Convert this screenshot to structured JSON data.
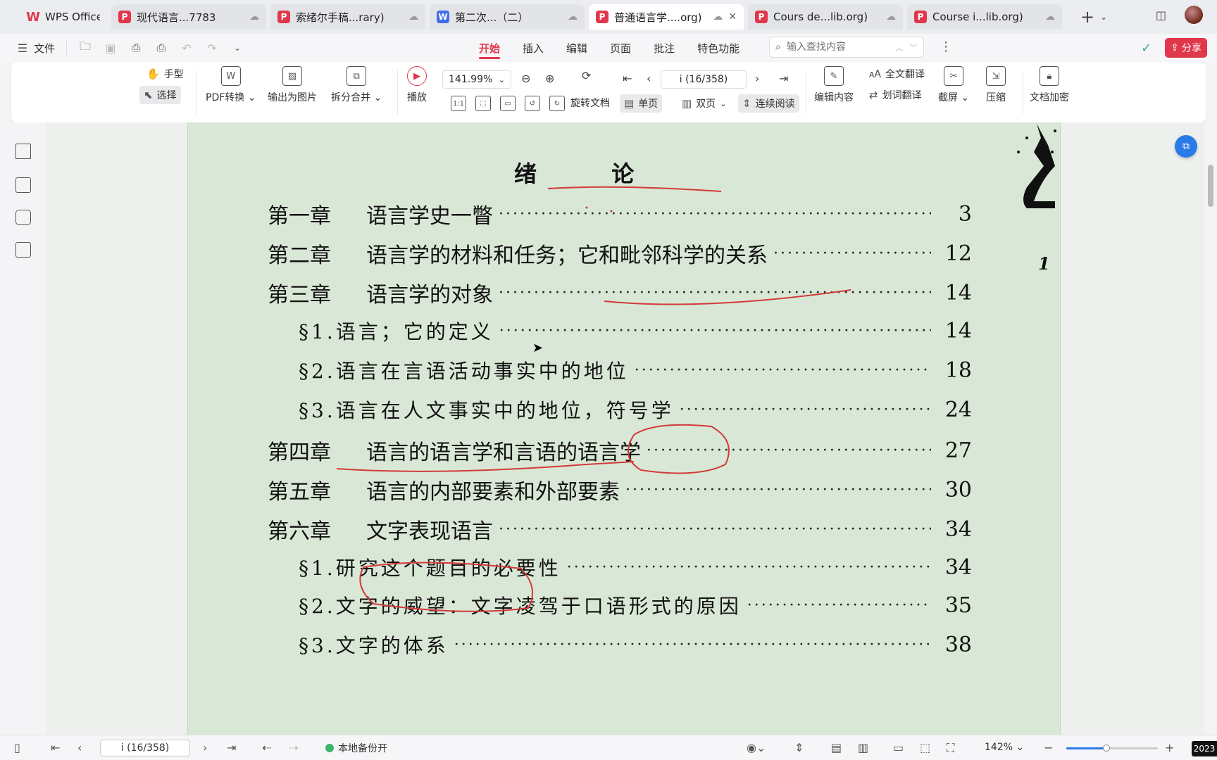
{
  "tabs": [
    {
      "label": "WPS Office",
      "icon": "wps-logo-icon",
      "type": "home"
    },
    {
      "label": "现代语言...7783",
      "icon": "pdf-icon",
      "type": "doc"
    },
    {
      "label": "索绪尔手稿...rary)",
      "icon": "pdf-icon",
      "type": "doc"
    },
    {
      "label": "第二次...（二）",
      "icon": "word-icon",
      "type": "doc"
    },
    {
      "label": "普通语言学....org)",
      "icon": "pdf-icon",
      "type": "doc",
      "active": true
    },
    {
      "label": "Cours de...lib.org)",
      "icon": "pdf-icon",
      "type": "doc"
    },
    {
      "label": "Course i...lib.org)",
      "icon": "pdf-icon",
      "type": "doc"
    }
  ],
  "menu": {
    "file_label": "文件",
    "tabs": [
      "开始",
      "插入",
      "编辑",
      "页面",
      "批注",
      "特色功能"
    ],
    "active_tab": "开始",
    "search_placeholder": "输入查找内容",
    "share_label": "分享"
  },
  "ribbon": {
    "hand_label": "手型",
    "select_label": "选择",
    "pdf_convert_label": "PDF转换",
    "export_image_label": "输出为图片",
    "split_merge_label": "拆分合并",
    "play_label": "播放",
    "zoom_value": "141.99%",
    "page_value": "i (16/358)",
    "rotate_label": "旋转文档",
    "single_page_label": "单页",
    "double_page_label": "双页",
    "continuous_label": "连续阅读",
    "edit_content_label": "编辑内容",
    "full_translate_label": "全文翻译",
    "word_translate_label": "划词翻译",
    "screenshot_label": "截屏",
    "compress_label": "压缩",
    "encrypt_label": "文档加密"
  },
  "document": {
    "title_left": "绪",
    "title_right": "论",
    "margin_number": "1",
    "toc": [
      {
        "chapter": "第一章",
        "title": "语言学史一瞥",
        "page": "3",
        "level": 1
      },
      {
        "chapter": "第二章",
        "title": "语言学的材料和任务；它和毗邻科学的关系",
        "page": "12",
        "level": 1
      },
      {
        "chapter": "第三章",
        "title": "语言学的对象",
        "page": "14",
        "level": 1
      },
      {
        "chapter": "",
        "title": "§1.语言；它的定义",
        "page": "14",
        "level": 2
      },
      {
        "chapter": "",
        "title": "§2.语言在言语活动事实中的地位",
        "page": "18",
        "level": 2
      },
      {
        "chapter": "",
        "title": "§3.语言在人文事实中的地位，符号学",
        "page": "24",
        "level": 2
      },
      {
        "chapter": "第四章",
        "title": "语言的语言学和言语的语言学",
        "page": "27",
        "level": 1
      },
      {
        "chapter": "第五章",
        "title": "语言的内部要素和外部要素",
        "page": "30",
        "level": 1
      },
      {
        "chapter": "第六章",
        "title": "文字表现语言",
        "page": "34",
        "level": 1
      },
      {
        "chapter": "",
        "title": "§1.研究这个题目的必要性",
        "page": "34",
        "level": 2
      },
      {
        "chapter": "",
        "title": "§2.文字的威望：文字凌驾于口语形式的原因",
        "page": "35",
        "level": 2
      },
      {
        "chapter": "",
        "title": "§3.文字的体系",
        "page": "38",
        "level": 2
      }
    ],
    "dots": "·······························································································"
  },
  "statusbar": {
    "page_value": "i (16/358)",
    "backup_label": "本地备份开",
    "zoom_label": "142%",
    "zoom_fraction": 0.44,
    "year_badge": "2023"
  },
  "colors": {
    "accent": "#e0374b",
    "page_bg": "#d9e8d6",
    "annotation": "#d23a3a"
  }
}
